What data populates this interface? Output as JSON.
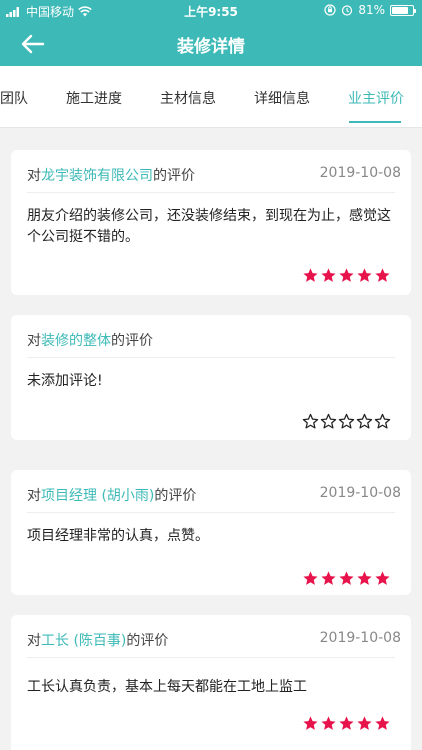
{
  "status_bar": {
    "carrier": "中国移动",
    "time": "上午9:55",
    "battery": "81%",
    "battery_level": 0.81,
    "icons": [
      "signal-icon",
      "wifi-icon",
      "rotation-lock-icon",
      "alarm-icon",
      "battery-icon"
    ]
  },
  "nav": {
    "title": "装修详情",
    "back_icon": "back-arrow-icon"
  },
  "tabs": [
    {
      "label": "团队",
      "active": false
    },
    {
      "label": "施工进度",
      "active": false
    },
    {
      "label": "主材信息",
      "active": false
    },
    {
      "label": "详细信息",
      "active": false
    },
    {
      "label": "业主评价",
      "active": true
    }
  ],
  "reviews": [
    {
      "prefix": "对",
      "target": "龙宇装饰有限公司",
      "suffix": "的评价",
      "date": "2019-10-08",
      "content": "朋友介绍的装修公司，还没装修结束，到现在为止，感觉这个公司挺不错的。",
      "rating": 5
    },
    {
      "prefix": "对",
      "target": "装修的整体",
      "suffix": "的评价",
      "date": "",
      "content": "未添加评论!",
      "rating": 0
    },
    {
      "prefix": "对",
      "target": "项目经理 (胡小雨)",
      "suffix": "的评价",
      "date": "2019-10-08",
      "content": "项目经理非常的认真，点赞。",
      "rating": 5
    },
    {
      "prefix": "对",
      "target": "工长 (陈百事)",
      "suffix": "的评价",
      "date": "2019-10-08",
      "content": "工长认真负责，基本上每天都能在工地上监工",
      "rating": 5
    }
  ],
  "colors": {
    "accent": "#3dbab7",
    "star_filled": "#e8134a",
    "star_empty": "#222222",
    "background": "#f2f2f2"
  }
}
